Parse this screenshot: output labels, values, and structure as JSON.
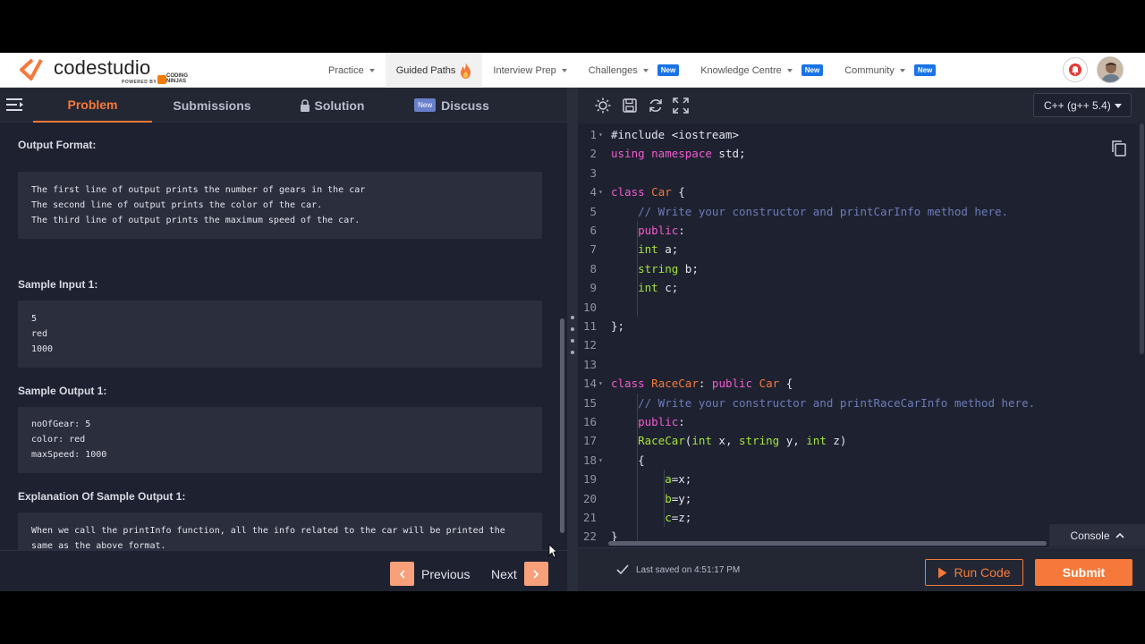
{
  "header": {
    "brand": "codestudio",
    "powered_by": "POWERED BY",
    "partner_line1": "CODING",
    "partner_line2": "NINJAS",
    "nav": [
      {
        "label": "Practice",
        "badge": null
      },
      {
        "label": "Guided Paths",
        "badge": null
      },
      {
        "label": "Interview Prep",
        "badge": null
      },
      {
        "label": "Challenges",
        "badge": "New"
      },
      {
        "label": "Knowledge Centre",
        "badge": "New"
      },
      {
        "label": "Community",
        "badge": "New"
      }
    ]
  },
  "left_panel": {
    "tabs": {
      "problem": "Problem",
      "submissions": "Submissions",
      "solution": "Solution",
      "discuss_badge": "New",
      "discuss": "Discuss"
    },
    "output_format_title": "Output Format:",
    "output_format_lines": [
      "The first line of output prints the number of gears in the car",
      "The second line of output prints the color of the car.",
      "The third line of output prints the maximum speed of the car."
    ],
    "sample_input_title": "Sample Input 1:",
    "sample_input_lines": [
      "5",
      "red",
      "1000"
    ],
    "sample_output_title": "Sample Output 1:",
    "sample_output_lines": [
      "noOfGear: 5",
      "color: red",
      "maxSpeed: 1000"
    ],
    "explanation_title": "Explanation Of Sample Output 1:",
    "explanation_lines": [
      "When we call the printInfo function, all the info related to the car will be printed the",
      "same as the above format."
    ],
    "prev_label": "Previous",
    "next_label": "Next"
  },
  "right_panel": {
    "language": "C++ (g++ 5.4)",
    "console_label": "Console",
    "last_saved": "Last saved on 4:51:17 PM",
    "run_label": "Run Code",
    "submit_label": "Submit"
  },
  "colors": {
    "accent": "#f5793a",
    "keyword": "#f25bce",
    "type": "#a5e33a",
    "comment": "#6c7bb8",
    "panel_bg": "#1e2230",
    "new_badge": "#1a73e8"
  },
  "icons": [
    "menu-icon",
    "lock-icon",
    "sun-icon",
    "save-icon",
    "reset-icon",
    "fullscreen-icon",
    "copy-icon",
    "bell-icon",
    "check-icon",
    "play-icon",
    "chevron-left-icon",
    "chevron-right-icon",
    "chevron-up-icon",
    "flame-icon"
  ]
}
